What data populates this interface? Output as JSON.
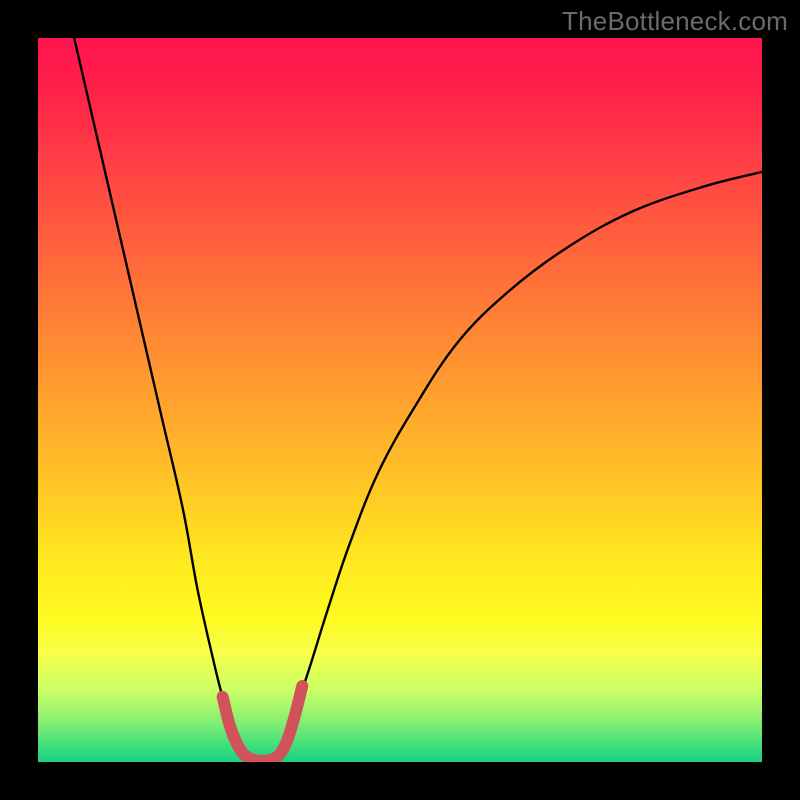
{
  "watermark": "TheBottleneck.com",
  "chart_data": {
    "type": "line",
    "title": "",
    "xlabel": "",
    "ylabel": "",
    "xlim": [
      0,
      100
    ],
    "ylim": [
      0,
      100
    ],
    "grid": false,
    "legend": false,
    "series": [
      {
        "name": "left-branch",
        "color": "#000000",
        "x": [
          5,
          8,
          11,
          14,
          17,
          20,
          22,
          24,
          25.5,
          27,
          28,
          28.8
        ],
        "y": [
          100,
          87,
          74,
          61,
          48,
          35,
          24,
          15,
          9,
          5,
          2.5,
          0.5
        ]
      },
      {
        "name": "right-branch",
        "color": "#000000",
        "x": [
          33,
          34,
          35.5,
          37.5,
          40,
          43,
          47,
          52,
          58,
          65,
          73,
          82,
          92,
          100
        ],
        "y": [
          0.5,
          3,
          7,
          13,
          21,
          30,
          40,
          49,
          58,
          65,
          71,
          76,
          79.5,
          81.5
        ]
      },
      {
        "name": "bottom-highlight",
        "color": "#d1525a",
        "x": [
          25.5,
          26.5,
          27.5,
          28.5,
          29.5,
          30.5,
          31.5,
          32.5,
          33.5,
          34.5,
          35.5,
          36.5
        ],
        "y": [
          9,
          5,
          2.5,
          1,
          0.4,
          0.2,
          0.2,
          0.4,
          1.2,
          3.2,
          6.5,
          10.5
        ]
      }
    ]
  }
}
